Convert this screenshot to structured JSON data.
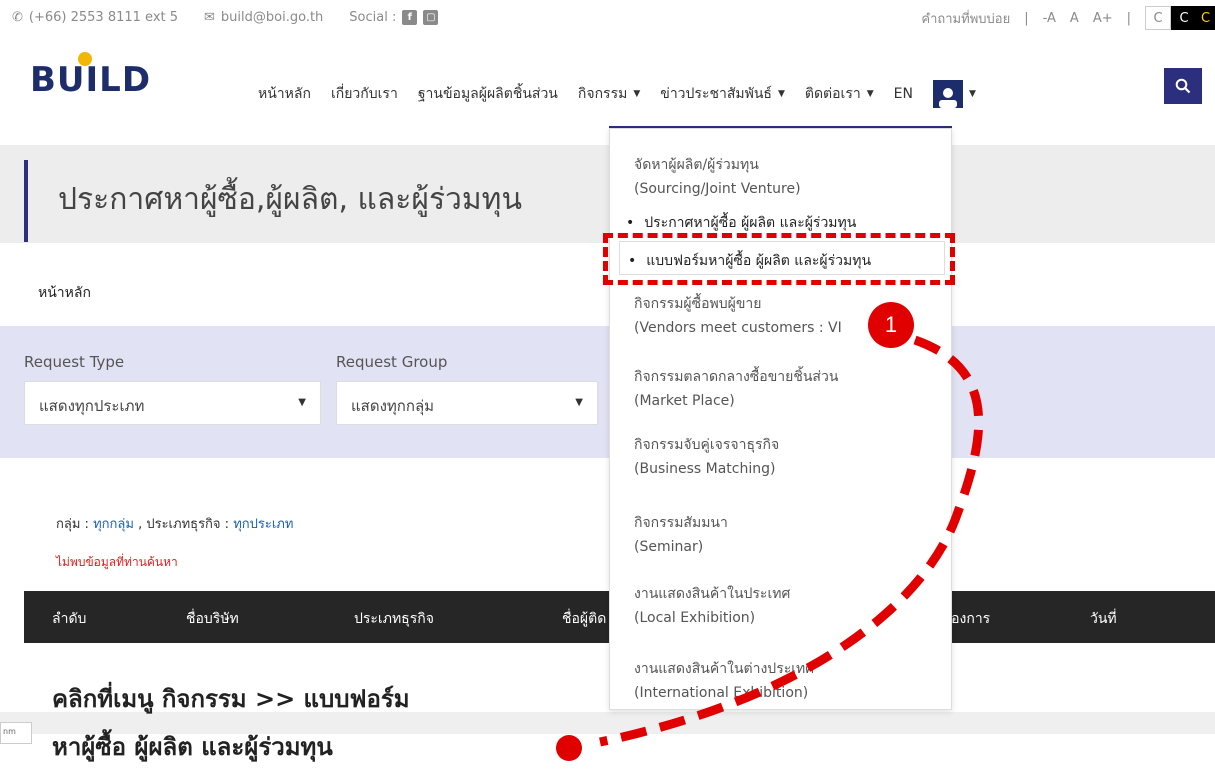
{
  "topbar": {
    "phone": "(+66) 2553 8111 ext 5",
    "email": "build@boi.go.th",
    "social_label": "Social :",
    "social_icons": [
      "facebook-icon",
      "line-icon"
    ],
    "faq": "คำถามที่พบบ่อย",
    "divider": "|",
    "font_small": "-A",
    "font_normal": "A",
    "font_large": "A+",
    "contrast": [
      "C",
      "C",
      "C"
    ]
  },
  "logo": {
    "text": "BUILD"
  },
  "nav": {
    "items": [
      {
        "label": "หน้าหลัก"
      },
      {
        "label": "เกี่ยวกับเรา"
      },
      {
        "label": "ฐานข้อมูลผู้ผลิตชิ้นส่วน"
      },
      {
        "label": "กิจกรรม",
        "caret": "▼"
      },
      {
        "label": "ข่าวประชาสัมพันธ์",
        "caret": "▼"
      },
      {
        "label": "ติดต่อเรา",
        "caret": "▼"
      },
      {
        "label": "EN"
      }
    ],
    "user_caret": "▼"
  },
  "page": {
    "title": "ประกาศหาผู้ซื้อ,ผู้ผลิต, และผู้ร่วมทุน",
    "breadcrumb": "หน้าหลัก"
  },
  "filters": {
    "request_type_label": "Request Type",
    "request_type_value": "แสดงทุกประเภท",
    "request_group_label": "Request Group",
    "request_group_value": "แสดงทุกกลุ่ม"
  },
  "summary": {
    "group_label": "กลุ่ม :",
    "group_value": "ทุกกลุ่ม",
    "sep": ",",
    "type_label": "ประเภทธุรกิจ :",
    "type_value": "ทุกประเภท",
    "not_found": "ไม่พบข้อมูลที่ท่านค้นหา"
  },
  "table": {
    "headers": [
      "ลำดับ",
      "ชื่อบริษัท",
      "ประเภทธุรกิจ",
      "ชื่อผู้ติด",
      "ต้องการ",
      "วันที่"
    ]
  },
  "dropdown": {
    "sourcing_th": "จัดหาผู้ผลิต/ผู้ร่วมทุน",
    "sourcing_en": "(Sourcing/Joint Venture)",
    "sub1": "ประกาศหาผู้ซื้อ ผู้ผลิต และผู้ร่วมทุน",
    "sub2": "แบบฟอร์มหาผู้ซื้อ ผู้ผลิต และผู้ร่วมทุน",
    "bullet": "•",
    "vendors_th": "กิจกรรมผู้ซื้อพบผู้ขาย",
    "vendors_en": "(Vendors meet customers : VI",
    "market_th": "กิจกรรมตลาดกลางซื้อขายชิ้นส่วน",
    "market_en": "(Market Place)",
    "matching_th": "กิจกรรมจับคู่เจรจาธุรกิจ",
    "matching_en": "(Business Matching)",
    "seminar_th": "กิจกรรมสัมมนา",
    "seminar_en": "(Seminar)",
    "local_th": "งานแสดงสินค้าในประเทศ",
    "local_en": "(Local Exhibition)",
    "intl_th": "งานแสดงสินค้าในต่างประเทศ",
    "intl_en": "(International Exhibition)"
  },
  "annotation": {
    "step": "1",
    "instruction_line1": "คลิกที่เมนู กิจกรรม >> แบบฟอร์ม",
    "instruction_line2": "หาผู้ซื้อ ผู้ผลิต และผู้ร่วมทุน",
    "color": "#e00000"
  },
  "colors": {
    "brand_navy": "#1d2d6b",
    "accent_purple": "#2b2f7e",
    "filter_bg": "#e1e3f4"
  }
}
